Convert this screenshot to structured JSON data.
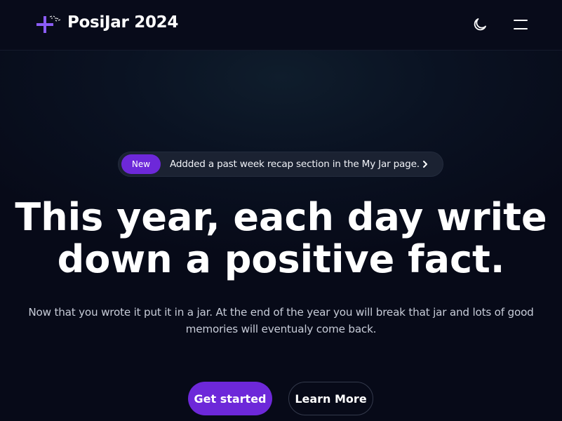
{
  "header": {
    "brand": "PosiJar 2024",
    "logo_icon": "sparkle-plus-icon",
    "theme_icon": "moon-icon",
    "menu_icon": "hamburger-menu-icon"
  },
  "announcement": {
    "badge": "New",
    "text": "Addded a past week recap section in the My Jar page.",
    "icon": "chevron-right-icon"
  },
  "hero": {
    "headline_line1": "This year, each day write",
    "headline_line2": "down a positive fact.",
    "subtext": "Now that you wrote it put it in a jar. At the end of the year you will break that jar and lots of good memories will eventualy come back."
  },
  "actions": {
    "primary": "Get started",
    "secondary": "Learn More"
  },
  "colors": {
    "accent": "#6d28d9",
    "background": "#070a18",
    "pill": "#1b2232"
  }
}
